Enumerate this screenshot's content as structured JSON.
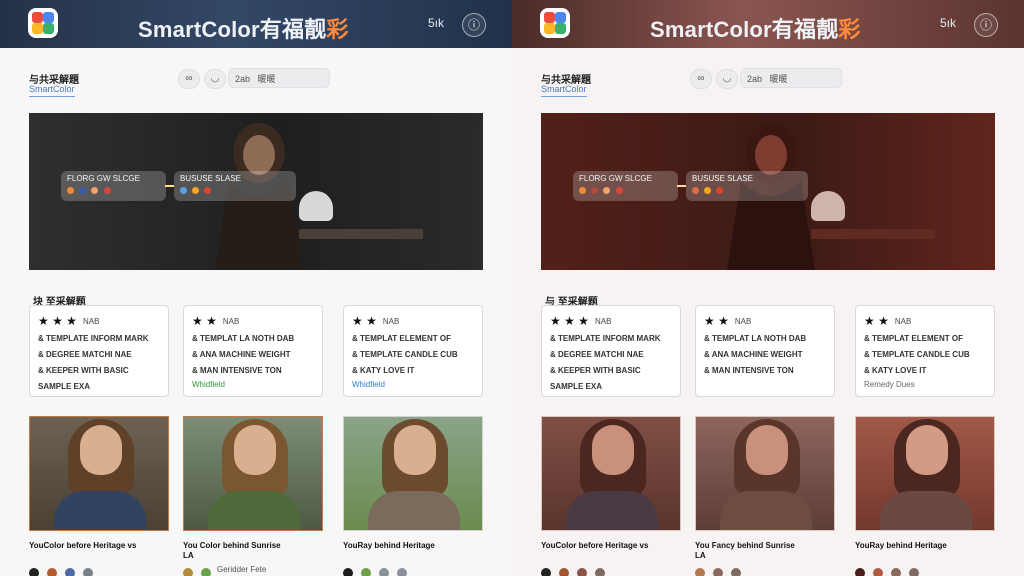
{
  "header": {
    "title_prefix": "SmartColor有福靓",
    "title_suffix": "彩",
    "signin_label": "5ık",
    "info_glyph": "ⓘ"
  },
  "left": {
    "nav_title": "与共采解題",
    "nav_sub": "SmartColor",
    "pills": [
      "∞",
      "◡"
    ],
    "search_label": "2ab",
    "search_value": "暖暖",
    "tooltip_left": {
      "title": "FLORG GW SLCGE",
      "dots": [
        "#f08a3a",
        "#3b5ea8",
        "#f2a36b",
        "#d44a39"
      ]
    },
    "tooltip_right": {
      "title": "BUSUSE SLASE",
      "dots": [
        "#5aa1e8",
        "#f5a623",
        "#d9472b"
      ]
    },
    "section_title": "块 至采解题",
    "cards": [
      {
        "stars": "★ ★ ★",
        "badge": "NAB",
        "lines": [
          "& TEMPLATE INFORM MARK",
          "& DEGREE MATCHI NAE",
          "& KEEPER WITH BASIC",
          "SAMPLE EXA"
        ],
        "tag": "",
        "tag_color": "#333333"
      },
      {
        "stars": "★ ★",
        "badge": "NAB",
        "lines": [
          "& TEMPLAT LA NOTH DAB",
          "& ANA MACHINE WEIGHT",
          "& MAN INTENSIVE TON",
          ""
        ],
        "tag": "Whidfield",
        "tag_color": "#2f9a3b"
      },
      {
        "stars": "★ ★",
        "badge": "NAB",
        "lines": [
          "& TEMPLAT ELEMENT OF",
          "& TEMPLATE CANDLE CUB",
          "& KATY LOVE IT",
          ""
        ],
        "tag": "Whidfield",
        "tag_color": "#2f7ed8"
      }
    ],
    "thumb_captions": [
      "YouColor before Heritage vs",
      "You Color behind Sunrise LA",
      "YouRay behind Heritage"
    ],
    "swatches": [
      {
        "colors": [
          "#222222",
          "#b45a2f",
          "#4d6aa1",
          "#7b7f87"
        ],
        "label": ""
      },
      {
        "colors": [
          "#b18c3c",
          "#6ba04e"
        ],
        "label": "Geridder Fete"
      },
      {
        "colors": [
          "#1d1d1d",
          "#6d9f4a",
          "#8a8f98",
          "#8a8f98"
        ],
        "label": ""
      }
    ]
  },
  "right": {
    "nav_title": "与共采解題",
    "nav_sub": "SmartColor",
    "pills": [
      "∞",
      "◡"
    ],
    "search_label": "2ab",
    "search_value": "暖暖",
    "tooltip_left": {
      "title": "FLORG GW SLCGE",
      "dots": [
        "#f08a3a",
        "#b04a3a",
        "#f2a36b",
        "#d44a39"
      ]
    },
    "tooltip_right": {
      "title": "BUSUSE SLASE",
      "dots": [
        "#e06d4a",
        "#f5a623",
        "#d9472b"
      ]
    },
    "section_title": "与 至采解题",
    "cards": [
      {
        "stars": "★ ★ ★",
        "badge": "NAB",
        "lines": [
          "& TEMPLATE INFORM MARK",
          "& DEGREE MATCHI NAE",
          "& KEEPER WITH BASIC",
          "SAMPLE EXA"
        ],
        "tag": "",
        "tag_color": "#333333"
      },
      {
        "stars": "★ ★",
        "badge": "NAB",
        "lines": [
          "& TEMPLAT LA NOTH DAB",
          "& ANA MACHINE WEIGHT",
          "& MAN INTENSIVE TON",
          ""
        ],
        "tag": "",
        "tag_color": "#333333"
      },
      {
        "stars": "★ ★",
        "badge": "NAB",
        "lines": [
          "& TEMPLAT ELEMENT OF",
          "& TEMPLATE CANDLE CUB",
          "& KATY LOVE IT",
          ""
        ],
        "tag": "Remedy Dues",
        "tag_color": "#666666"
      }
    ],
    "thumb_captions": [
      "YouColor before Heritage vs",
      "You Fancy behind Sunrise LA",
      "YouRay behind Heritage"
    ],
    "swatches": [
      {
        "colors": [
          "#222222",
          "#a2562f",
          "#8b5548",
          "#7d6b64"
        ],
        "label": ""
      },
      {
        "colors": [
          "#b37a52",
          "#8b6a60",
          "#7d6b64"
        ],
        "label": ""
      },
      {
        "colors": [
          "#4a1f1a",
          "#b05b44",
          "#8b6a60",
          "#7d6b64"
        ],
        "label": ""
      }
    ]
  }
}
